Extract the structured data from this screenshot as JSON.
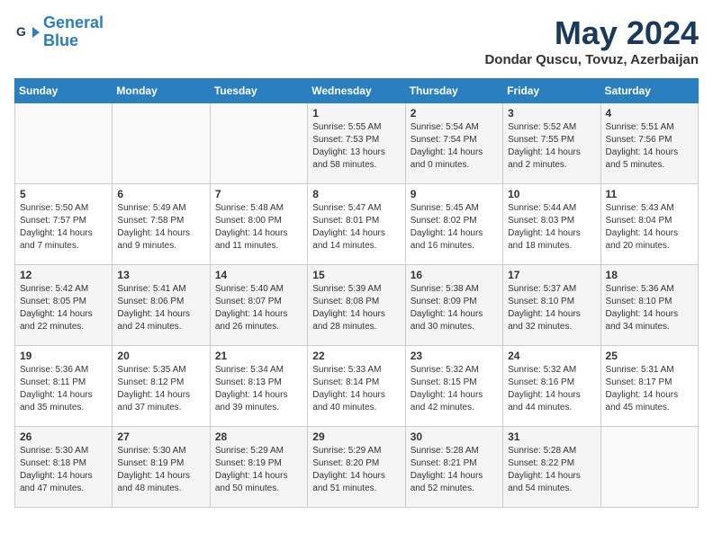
{
  "header": {
    "logo_line1": "General",
    "logo_line2": "Blue",
    "month_title": "May 2024",
    "location": "Dondar Quscu, Tovuz, Azerbaijan"
  },
  "days_of_week": [
    "Sunday",
    "Monday",
    "Tuesday",
    "Wednesday",
    "Thursday",
    "Friday",
    "Saturday"
  ],
  "weeks": [
    [
      {
        "day": "",
        "info": ""
      },
      {
        "day": "",
        "info": ""
      },
      {
        "day": "",
        "info": ""
      },
      {
        "day": "1",
        "info": "Sunrise: 5:55 AM\nSunset: 7:53 PM\nDaylight: 13 hours\nand 58 minutes."
      },
      {
        "day": "2",
        "info": "Sunrise: 5:54 AM\nSunset: 7:54 PM\nDaylight: 14 hours\nand 0 minutes."
      },
      {
        "day": "3",
        "info": "Sunrise: 5:52 AM\nSunset: 7:55 PM\nDaylight: 14 hours\nand 2 minutes."
      },
      {
        "day": "4",
        "info": "Sunrise: 5:51 AM\nSunset: 7:56 PM\nDaylight: 14 hours\nand 5 minutes."
      }
    ],
    [
      {
        "day": "5",
        "info": "Sunrise: 5:50 AM\nSunset: 7:57 PM\nDaylight: 14 hours\nand 7 minutes."
      },
      {
        "day": "6",
        "info": "Sunrise: 5:49 AM\nSunset: 7:58 PM\nDaylight: 14 hours\nand 9 minutes."
      },
      {
        "day": "7",
        "info": "Sunrise: 5:48 AM\nSunset: 8:00 PM\nDaylight: 14 hours\nand 11 minutes."
      },
      {
        "day": "8",
        "info": "Sunrise: 5:47 AM\nSunset: 8:01 PM\nDaylight: 14 hours\nand 14 minutes."
      },
      {
        "day": "9",
        "info": "Sunrise: 5:45 AM\nSunset: 8:02 PM\nDaylight: 14 hours\nand 16 minutes."
      },
      {
        "day": "10",
        "info": "Sunrise: 5:44 AM\nSunset: 8:03 PM\nDaylight: 14 hours\nand 18 minutes."
      },
      {
        "day": "11",
        "info": "Sunrise: 5:43 AM\nSunset: 8:04 PM\nDaylight: 14 hours\nand 20 minutes."
      }
    ],
    [
      {
        "day": "12",
        "info": "Sunrise: 5:42 AM\nSunset: 8:05 PM\nDaylight: 14 hours\nand 22 minutes."
      },
      {
        "day": "13",
        "info": "Sunrise: 5:41 AM\nSunset: 8:06 PM\nDaylight: 14 hours\nand 24 minutes."
      },
      {
        "day": "14",
        "info": "Sunrise: 5:40 AM\nSunset: 8:07 PM\nDaylight: 14 hours\nand 26 minutes."
      },
      {
        "day": "15",
        "info": "Sunrise: 5:39 AM\nSunset: 8:08 PM\nDaylight: 14 hours\nand 28 minutes."
      },
      {
        "day": "16",
        "info": "Sunrise: 5:38 AM\nSunset: 8:09 PM\nDaylight: 14 hours\nand 30 minutes."
      },
      {
        "day": "17",
        "info": "Sunrise: 5:37 AM\nSunset: 8:10 PM\nDaylight: 14 hours\nand 32 minutes."
      },
      {
        "day": "18",
        "info": "Sunrise: 5:36 AM\nSunset: 8:10 PM\nDaylight: 14 hours\nand 34 minutes."
      }
    ],
    [
      {
        "day": "19",
        "info": "Sunrise: 5:36 AM\nSunset: 8:11 PM\nDaylight: 14 hours\nand 35 minutes."
      },
      {
        "day": "20",
        "info": "Sunrise: 5:35 AM\nSunset: 8:12 PM\nDaylight: 14 hours\nand 37 minutes."
      },
      {
        "day": "21",
        "info": "Sunrise: 5:34 AM\nSunset: 8:13 PM\nDaylight: 14 hours\nand 39 minutes."
      },
      {
        "day": "22",
        "info": "Sunrise: 5:33 AM\nSunset: 8:14 PM\nDaylight: 14 hours\nand 40 minutes."
      },
      {
        "day": "23",
        "info": "Sunrise: 5:32 AM\nSunset: 8:15 PM\nDaylight: 14 hours\nand 42 minutes."
      },
      {
        "day": "24",
        "info": "Sunrise: 5:32 AM\nSunset: 8:16 PM\nDaylight: 14 hours\nand 44 minutes."
      },
      {
        "day": "25",
        "info": "Sunrise: 5:31 AM\nSunset: 8:17 PM\nDaylight: 14 hours\nand 45 minutes."
      }
    ],
    [
      {
        "day": "26",
        "info": "Sunrise: 5:30 AM\nSunset: 8:18 PM\nDaylight: 14 hours\nand 47 minutes."
      },
      {
        "day": "27",
        "info": "Sunrise: 5:30 AM\nSunset: 8:19 PM\nDaylight: 14 hours\nand 48 minutes."
      },
      {
        "day": "28",
        "info": "Sunrise: 5:29 AM\nSunset: 8:19 PM\nDaylight: 14 hours\nand 50 minutes."
      },
      {
        "day": "29",
        "info": "Sunrise: 5:29 AM\nSunset: 8:20 PM\nDaylight: 14 hours\nand 51 minutes."
      },
      {
        "day": "30",
        "info": "Sunrise: 5:28 AM\nSunset: 8:21 PM\nDaylight: 14 hours\nand 52 minutes."
      },
      {
        "day": "31",
        "info": "Sunrise: 5:28 AM\nSunset: 8:22 PM\nDaylight: 14 hours\nand 54 minutes."
      },
      {
        "day": "",
        "info": ""
      }
    ]
  ]
}
